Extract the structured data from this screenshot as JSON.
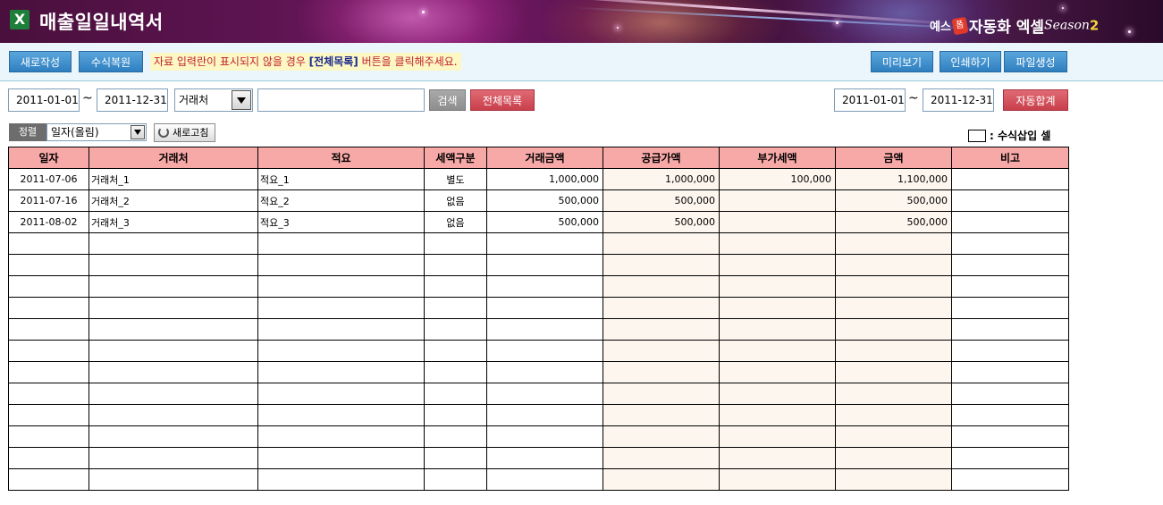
{
  "header": {
    "app_icon": "excel-icon",
    "title": "매출일일내역서",
    "brand": {
      "prefix": "예스",
      "pen_mark": "폼",
      "name": "자동화 엑셀",
      "season_word": "Season",
      "season_number": "2"
    }
  },
  "toolbar": {
    "new_label": "새로작성",
    "restore_label": "수식복원",
    "notice_before": "자료 입력란이 표시되지  않을 경우 ",
    "notice_emph": "[전체목록]",
    "notice_after": " 버튼을 클릭해주세요.",
    "preview_label": "미리보기",
    "print_label": "인쇄하기",
    "file_label": "파일생성"
  },
  "search": {
    "date_from": "2011-01-01",
    "tilde": "~",
    "date_to": "2011-12-31",
    "field_select": "거래처",
    "keyword": "",
    "search_label": "검색",
    "all_label": "전체목록",
    "sum_date_from": "2011-01-01",
    "sum_date_to": "2011-12-31",
    "auto_sum_label": "자동합계"
  },
  "sort": {
    "label": "정렬",
    "value": "일자(올림)",
    "refresh_label": "새로고침",
    "legend_label": ": 수식삽입 셀"
  },
  "table": {
    "columns": [
      "일자",
      "거래처",
      "적요",
      "세액구분",
      "거래금액",
      "공급가액",
      "부가세액",
      "금액",
      "비고"
    ],
    "rows": [
      [
        "2011-07-06",
        "거래처_1",
        "적요_1",
        "별도",
        "1,000,000",
        "1,000,000",
        "100,000",
        "1,100,000",
        ""
      ],
      [
        "2011-07-16",
        "거래처_2",
        "적요_2",
        "없음",
        "500,000",
        "500,000",
        "",
        "500,000",
        ""
      ],
      [
        "2011-08-02",
        "거래처_3",
        "적요_3",
        "없음",
        "500,000",
        "500,000",
        "",
        "500,000",
        ""
      ]
    ],
    "empty_row_count": 12,
    "formula_columns": [
      5,
      6,
      7
    ]
  },
  "colors": {
    "header_bg": "#f7a9a7",
    "formula_cell_bg": "#fdf6ee",
    "toolbar_bg": "#eaf6fb",
    "blue_button": "#2f7fc0",
    "red_button": "#c8404c",
    "notice_text": "#c0202a"
  }
}
